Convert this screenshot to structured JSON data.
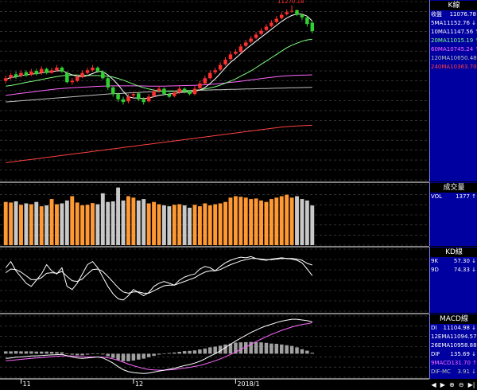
{
  "panels": {
    "k": {
      "title": "K線",
      "rows": [
        {
          "label": "收盤",
          "value": "11076.78",
          "color": "#ffffff"
        },
        {
          "label": "5MA",
          "value": "11152.76 ↓",
          "color": "#ffffff"
        },
        {
          "label": "10MA",
          "value": "11147.56 ↑",
          "color": "#ffffff"
        },
        {
          "label": "20MA",
          "value": "11015.19 ↑",
          "color": "#7fff7f"
        },
        {
          "label": "60MA",
          "value": "10745.24 ↑",
          "color": "#ff66ff"
        },
        {
          "label": "120MA",
          "value": "10650.48 ↑",
          "color": "#c0c0c0"
        },
        {
          "label": "240MA",
          "value": "10363.70 ↑",
          "color": "#ff4040"
        }
      ],
      "high_label": "11270.18"
    },
    "vol": {
      "title": "成交量",
      "rows": [
        {
          "label": "VOL",
          "value": "1377 ↑",
          "color": "#ffffff"
        }
      ]
    },
    "kd": {
      "title": "KD線",
      "rows": [
        {
          "label": "9K",
          "value": "57.30 ↓",
          "color": "#ffffff"
        },
        {
          "label": "9D",
          "value": "74.33 ↓",
          "color": "#ffffff"
        }
      ]
    },
    "macd": {
      "title": "MACD線",
      "rows": [
        {
          "label": "DI",
          "value": "11104.98 ↓",
          "color": "#ffffff"
        },
        {
          "label": "12EMA",
          "value": "11094.57 ↑",
          "color": "#ffffff"
        },
        {
          "label": "26EMA",
          "value": "10958.88 ↑",
          "color": "#ffffff"
        },
        {
          "label": "DIF",
          "value": "135.69 ↓",
          "color": "#ffffff"
        },
        {
          "label": "9MACD",
          "value": "131.70 ↑",
          "color": "#ff66ff"
        },
        {
          "label": "DIF-MC",
          "value": "3.91 ↓",
          "color": "#c0c0c0"
        }
      ]
    }
  },
  "x_labels": [
    {
      "text": "11",
      "index": 3
    },
    {
      "text": "12",
      "index": 25
    },
    {
      "text": "2018/1",
      "index": 45
    }
  ],
  "toolbar_icons": [
    "arrow-left-icon",
    "arrow-right-icon",
    "zoom-in-icon",
    "zoom-out-icon",
    "scroll-end-icon"
  ],
  "toolbar_glyphs": [
    "◀",
    "▶",
    "⊕",
    "⊖",
    "▶|"
  ],
  "colors": {
    "up": "#ff3030",
    "down": "#30d030",
    "vol_up": "#ff9933",
    "vol_down": "#c8c8c8",
    "ma5": "#ffffff",
    "ma10": "#ffff66",
    "ma20": "#7fff7f",
    "ma60": "#ff66ff",
    "ma120": "#c0c0c0",
    "ma240": "#ff4040"
  },
  "chart_data": {
    "type": "candlestick",
    "title": "",
    "x": [
      "11",
      "",
      "",
      "",
      "",
      "",
      "",
      "",
      "",
      "",
      "",
      "",
      "",
      "",
      "",
      "",
      "",
      "",
      "",
      "",
      "",
      "",
      "",
      "",
      "",
      "12",
      "",
      "",
      "",
      "",
      "",
      "",
      "",
      "",
      "",
      "",
      "",
      "",
      "",
      "",
      "",
      "",
      "",
      "",
      "",
      "2018/1",
      "",
      "",
      "",
      "",
      "",
      "",
      "",
      "",
      "",
      "",
      "",
      "",
      "",
      "",
      ""
    ],
    "close": [
      10720,
      10745,
      10730,
      10760,
      10740,
      10770,
      10750,
      10790,
      10760,
      10780,
      10800,
      10770,
      10690,
      10700,
      10730,
      10760,
      10780,
      10800,
      10770,
      10720,
      10650,
      10600,
      10560,
      10540,
      10580,
      10600,
      10560,
      10540,
      10580,
      10620,
      10640,
      10600,
      10580,
      10610,
      10640,
      10620,
      10600,
      10640,
      10680,
      10720,
      10760,
      10780,
      10820,
      10860,
      10900,
      10920,
      10960,
      10990,
      11020,
      11050,
      11080,
      11110,
      11140,
      11170,
      11200,
      11220,
      11230,
      11200,
      11180,
      11130,
      11076.78
    ],
    "open": [
      10700,
      10725,
      10750,
      10740,
      10765,
      10745,
      10775,
      10760,
      10790,
      10760,
      10780,
      10800,
      10760,
      10690,
      10700,
      10730,
      10760,
      10780,
      10800,
      10770,
      10720,
      10650,
      10600,
      10560,
      10545,
      10590,
      10605,
      10560,
      10545,
      10585,
      10625,
      10640,
      10600,
      10585,
      10610,
      10640,
      10620,
      10600,
      10645,
      10680,
      10720,
      10765,
      10785,
      10825,
      10865,
      10905,
      10920,
      10965,
      10995,
      11025,
      11055,
      11085,
      11115,
      11145,
      11175,
      11205,
      11225,
      11235,
      11200,
      11180,
      11140
    ],
    "high": [
      10740,
      10760,
      10770,
      10780,
      10780,
      10790,
      10790,
      10810,
      10800,
      10800,
      10820,
      10810,
      10770,
      10720,
      10745,
      10780,
      10800,
      10820,
      10810,
      10780,
      10730,
      10660,
      10610,
      10580,
      10600,
      10620,
      10615,
      10575,
      10600,
      10640,
      10660,
      10650,
      10610,
      10625,
      10660,
      10650,
      10630,
      10660,
      10700,
      10740,
      10780,
      10800,
      10840,
      10880,
      10920,
      10940,
      10980,
      11010,
      11040,
      11070,
      11100,
      11130,
      11160,
      11190,
      11220,
      11240,
      11270.18,
      11240,
      11210,
      11190,
      11150
    ],
    "low": [
      10680,
      10710,
      10715,
      10725,
      10730,
      10735,
      10740,
      10745,
      10750,
      10755,
      10770,
      10760,
      10680,
      10670,
      10690,
      10720,
      10750,
      10770,
      10760,
      10710,
      10630,
      10580,
      10540,
      10520,
      10530,
      10570,
      10545,
      10520,
      10535,
      10575,
      10610,
      10590,
      10570,
      10575,
      10600,
      10605,
      10590,
      10590,
      10630,
      10670,
      10710,
      10750,
      10775,
      10815,
      10855,
      10895,
      10910,
      10955,
      10985,
      11015,
      11045,
      11075,
      11105,
      11135,
      11165,
      11195,
      11215,
      11190,
      11160,
      11110,
      11060
    ],
    "ma": {
      "ma5": [
        10710,
        10725,
        10730,
        10740,
        10745,
        10750,
        10755,
        10760,
        10765,
        10770,
        10775,
        10778,
        10760,
        10745,
        10735,
        10730,
        10740,
        10755,
        10770,
        10770,
        10745,
        10710,
        10670,
        10620,
        10580,
        10570,
        10570,
        10565,
        10570,
        10580,
        10590,
        10595,
        10600,
        10605,
        10610,
        10615,
        10615,
        10620,
        10630,
        10650,
        10680,
        10715,
        10755,
        10800,
        10840,
        10870,
        10905,
        10940,
        10970,
        11000,
        11030,
        11060,
        11090,
        11120,
        11150,
        11175,
        11195,
        11205,
        11205,
        11190,
        11152.76
      ],
      "ma20": [
        10660,
        10665,
        10672,
        10680,
        10688,
        10695,
        10702,
        10710,
        10718,
        10725,
        10732,
        10738,
        10742,
        10744,
        10744,
        10742,
        10740,
        10740,
        10740,
        10738,
        10735,
        10728,
        10718,
        10705,
        10690,
        10675,
        10660,
        10648,
        10638,
        10630,
        10625,
        10622,
        10620,
        10620,
        10620,
        10622,
        10625,
        10628,
        10632,
        10638,
        10646,
        10655,
        10668,
        10682,
        10698,
        10715,
        10735,
        10755,
        10775,
        10800,
        10825,
        10850,
        10875,
        10900,
        10925,
        10950,
        10970,
        10985,
        11000,
        11010,
        11015.19
      ],
      "ma60": [
        10590,
        10595,
        10600,
        10605,
        10610,
        10615,
        10620,
        10625,
        10630,
        10634,
        10638,
        10642,
        10645,
        10648,
        10650,
        10652,
        10654,
        10656,
        10658,
        10660,
        10661,
        10662,
        10662,
        10662,
        10662,
        10662,
        10662,
        10661,
        10660,
        10660,
        10660,
        10660,
        10661,
        10662,
        10663,
        10664,
        10665,
        10666,
        10668,
        10670,
        10673,
        10676,
        10680,
        10684,
        10688,
        10692,
        10697,
        10702,
        10707,
        10712,
        10717,
        10722,
        10727,
        10731,
        10735,
        10738,
        10740,
        10742,
        10743,
        10744,
        10745.24
      ],
      "ma120": [
        10540,
        10543,
        10546,
        10549,
        10552,
        10555,
        10558,
        10561,
        10564,
        10567,
        10570,
        10573,
        10576,
        10579,
        10582,
        10585,
        10588,
        10591,
        10594,
        10597,
        10600,
        10602,
        10604,
        10606,
        10608,
        10610,
        10612,
        10614,
        10616,
        10618,
        10620,
        10622,
        10623,
        10624,
        10625,
        10626,
        10627,
        10628,
        10629,
        10630,
        10631,
        10632,
        10633,
        10634,
        10635,
        10636,
        10637,
        10638,
        10639,
        10640,
        10641,
        10642,
        10643,
        10644,
        10645,
        10646,
        10647,
        10648,
        10649,
        10650,
        10650.48
      ],
      "ma240": [
        10080,
        10085,
        10090,
        10095,
        10100,
        10105,
        10110,
        10115,
        10120,
        10125,
        10130,
        10135,
        10140,
        10145,
        10150,
        10155,
        10160,
        10165,
        10170,
        10175,
        10180,
        10185,
        10190,
        10195,
        10200,
        10205,
        10210,
        10215,
        10220,
        10225,
        10230,
        10235,
        10240,
        10245,
        10250,
        10255,
        10260,
        10265,
        10270,
        10275,
        10280,
        10285,
        10290,
        10295,
        10300,
        10305,
        10310,
        10315,
        10320,
        10325,
        10330,
        10335,
        10340,
        10345,
        10350,
        10353,
        10356,
        10358,
        10360,
        10362,
        10363.7
      ]
    },
    "ylim": [
      9950,
      11300
    ],
    "volume": [
      1500,
      1480,
      1520,
      1400,
      1450,
      1420,
      1500,
      1350,
      1380,
      1600,
      1420,
      1450,
      1550,
      1700,
      1480,
      1380,
      1400,
      1460,
      1420,
      1800,
      1500,
      1520,
      2000,
      1550,
      1700,
      1650,
      1550,
      1600,
      1450,
      1500,
      1420,
      1380,
      1350,
      1400,
      1420,
      1380,
      1300,
      1400,
      1350,
      1450,
      1380,
      1420,
      1450,
      1500,
      1650,
      1700,
      1680,
      1650,
      1600,
      1620,
      1550,
      1500,
      1600,
      1650,
      1700,
      1750,
      1650,
      1700,
      1600,
      1550,
      1377
    ],
    "vol_ylim": [
      0,
      2100
    ],
    "k9": [
      70,
      80,
      65,
      55,
      45,
      40,
      50,
      60,
      75,
      65,
      60,
      70,
      40,
      35,
      45,
      60,
      75,
      80,
      70,
      55,
      40,
      28,
      20,
      18,
      25,
      35,
      30,
      25,
      30,
      40,
      45,
      48,
      45,
      42,
      50,
      55,
      58,
      60,
      68,
      72,
      70,
      65,
      72,
      78,
      82,
      85,
      87,
      86,
      88,
      85,
      83,
      82,
      84,
      85,
      86,
      85,
      84,
      82,
      78,
      68,
      57.3
    ],
    "d9": [
      62,
      68,
      67,
      63,
      57,
      51,
      51,
      54,
      61,
      62,
      61,
      64,
      56,
      49,
      48,
      52,
      60,
      67,
      68,
      64,
      56,
      47,
      38,
      31,
      29,
      31,
      31,
      29,
      29,
      33,
      37,
      41,
      42,
      42,
      45,
      48,
      51,
      54,
      59,
      63,
      65,
      65,
      67,
      71,
      75,
      78,
      81,
      83,
      85,
      85,
      84,
      83,
      83,
      84,
      85,
      85,
      85,
      84,
      82,
      77,
      74.33
    ],
    "kd_ylim": [
      0,
      100
    ],
    "dif": [
      -20,
      -18,
      -15,
      -14,
      -12,
      -10,
      -9,
      -8,
      -6,
      -5,
      -4,
      -3,
      -8,
      -14,
      -18,
      -20,
      -18,
      -16,
      -14,
      -18,
      -28,
      -40,
      -55,
      -68,
      -76,
      -80,
      -82,
      -84,
      -82,
      -78,
      -74,
      -70,
      -66,
      -62,
      -56,
      -50,
      -46,
      -40,
      -32,
      -22,
      -10,
      0,
      12,
      26,
      40,
      54,
      66,
      78,
      90,
      100,
      110,
      118,
      125,
      132,
      138,
      142,
      146,
      146,
      143,
      140,
      135.69
    ],
    "macd9": [
      -30,
      -28,
      -26,
      -24,
      -22,
      -20,
      -18,
      -17,
      -15,
      -13,
      -11,
      -9,
      -9,
      -10,
      -11,
      -13,
      -14,
      -14,
      -14,
      -15,
      -17,
      -22,
      -28,
      -36,
      -44,
      -51,
      -57,
      -63,
      -67,
      -69,
      -70,
      -70,
      -69,
      -67,
      -64,
      -61,
      -58,
      -54,
      -50,
      -44,
      -37,
      -30,
      -22,
      -13,
      -3,
      7,
      18,
      29,
      40,
      51,
      62,
      72,
      82,
      90,
      99,
      106,
      113,
      119,
      124,
      127,
      131.7
    ],
    "macd_ylim": [
      -100,
      160
    ]
  }
}
